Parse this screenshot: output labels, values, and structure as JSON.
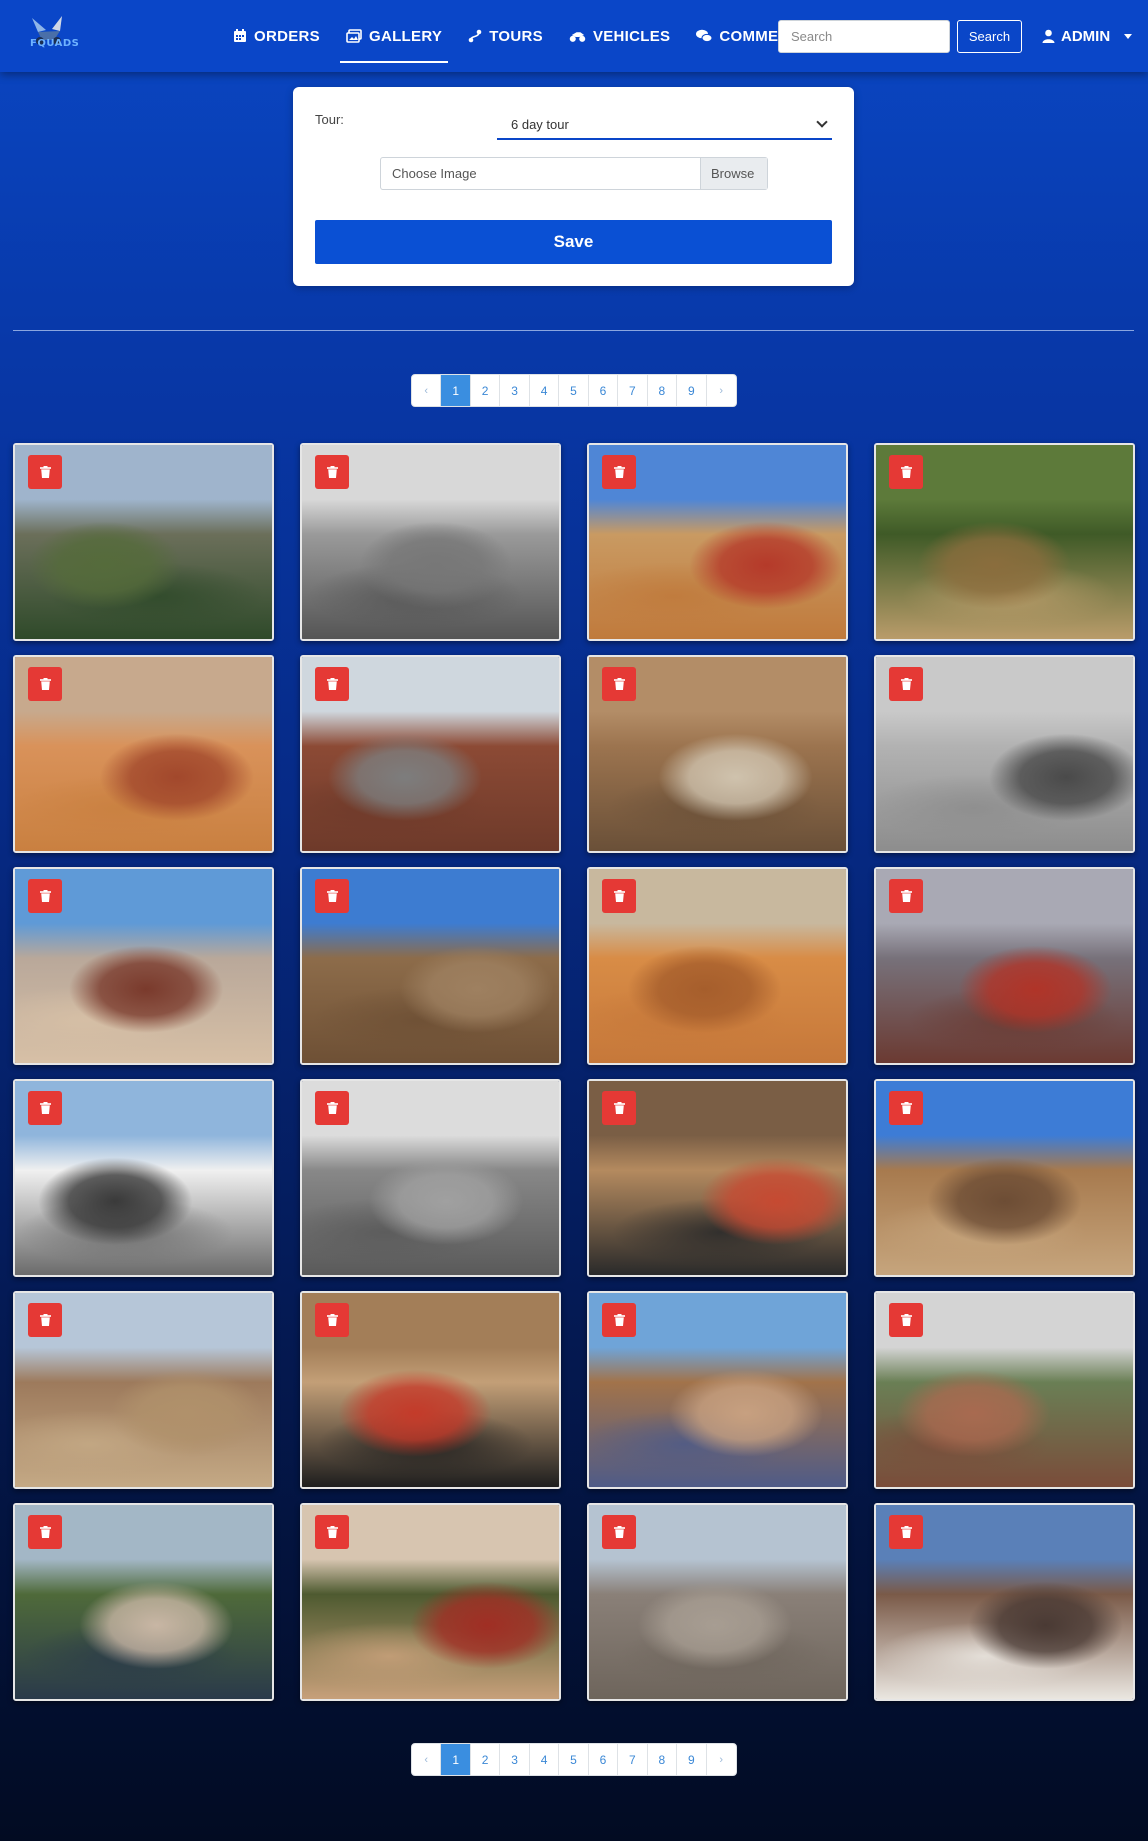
{
  "brand": {
    "logo_text": "FQUADS"
  },
  "nav": {
    "items": [
      {
        "label": "ORDERS",
        "icon": "calendar-icon"
      },
      {
        "label": "GALLERY",
        "icon": "images-icon",
        "active": true
      },
      {
        "label": "TOURS",
        "icon": "route-icon"
      },
      {
        "label": "VEHICLES",
        "icon": "quad-icon"
      },
      {
        "label": "COMMENTS",
        "icon": "comments-icon"
      }
    ],
    "search_placeholder": "Search",
    "search_button": "Search",
    "user_label": "ADMIN"
  },
  "form": {
    "tour_label": "Tour:",
    "tour_value": "6 day tour",
    "file_placeholder": "Choose Image",
    "browse_label": "Browse",
    "save_label": "Save"
  },
  "pagination": {
    "prev": "‹",
    "next": "›",
    "pages": [
      "1",
      "2",
      "3",
      "4",
      "5",
      "6",
      "7",
      "8",
      "9"
    ],
    "current": "1"
  },
  "colors": {
    "navbar": "#0a46c8",
    "accent": "#0a50d4",
    "delete": "#e53935",
    "page_active": "#3a8ee0"
  },
  "gallery": {
    "delete_icon": "trash-icon",
    "photos": [
      {
        "scene": "rider-in-helmet-palm-oasis",
        "palette": [
          "#9fb4cc",
          "#6b6f5a",
          "#2f4a2a",
          "#556b3b"
        ]
      },
      {
        "scene": "black-white-quad-palms",
        "palette": [
          "#d8d8d8",
          "#9a9a9a",
          "#555555",
          "#777777"
        ]
      },
      {
        "scene": "red-quads-on-dune",
        "palette": [
          "#4f86d6",
          "#c99a62",
          "#c07a3c",
          "#b53a2a"
        ]
      },
      {
        "scene": "quad-through-palm-grove",
        "palette": [
          "#5d7a3a",
          "#3f5a27",
          "#b99c6a",
          "#8a6d3d"
        ]
      },
      {
        "scene": "buggy-on-sand-dunes",
        "palette": [
          "#c7a98d",
          "#d9925a",
          "#c98040",
          "#a2482c"
        ]
      },
      {
        "scene": "quads-lined-before-kasbah",
        "palette": [
          "#cfd7de",
          "#8c4a35",
          "#6e3a2a",
          "#7d7d7d"
        ]
      },
      {
        "scene": "quads-in-canyon-gate",
        "palette": [
          "#b38d67",
          "#9c744f",
          "#6a5038",
          "#cfc2ad"
        ]
      },
      {
        "scene": "grey-quads-on-salt-flat",
        "palette": [
          "#c9c9c9",
          "#b2b2b2",
          "#8d8d8d",
          "#4a4a4a"
        ]
      },
      {
        "scene": "quad-near-kasbah-wall",
        "palette": [
          "#5f9ad7",
          "#b9a89a",
          "#d7c0a6",
          "#7a3a2c"
        ]
      },
      {
        "scene": "quad-on-rocky-plain",
        "palette": [
          "#3d7cd1",
          "#8d6c4a",
          "#6e5035",
          "#9e8060"
        ]
      },
      {
        "scene": "quads-on-orange-dunes",
        "palette": [
          "#c8b89e",
          "#d88c46",
          "#c6783a",
          "#a65e2c"
        ]
      },
      {
        "scene": "riders-celebrating-sunset",
        "palette": [
          "#a9a9b4",
          "#77717a",
          "#6b3a32",
          "#b03428"
        ]
      },
      {
        "scene": "hero-van-with-quads",
        "palette": [
          "#8fb5dc",
          "#f0f0f0",
          "#6b6b6b",
          "#3a3a3a"
        ]
      },
      {
        "scene": "bw-quads-rocky-hill",
        "palette": [
          "#dcdcdc",
          "#888888",
          "#5a5a5a",
          "#a0a0a0"
        ]
      },
      {
        "scene": "suv-in-village",
        "palette": [
          "#7a5e45",
          "#b48a5f",
          "#2a2a2a",
          "#c64a32"
        ]
      },
      {
        "scene": "quads-before-ait-ben-haddou",
        "palette": [
          "#3d7cd6",
          "#a77a4e",
          "#c6a57d",
          "#6d4d35"
        ]
      },
      {
        "scene": "quads-on-dusty-track",
        "palette": [
          "#b6c6d8",
          "#9d7a5c",
          "#c4a985",
          "#b0916b"
        ]
      },
      {
        "scene": "suv-with-graphics",
        "palette": [
          "#a37e58",
          "#c39f77",
          "#1e1e1e",
          "#c43b2a"
        ]
      },
      {
        "scene": "quad-in-souk-street",
        "palette": [
          "#6fa4d8",
          "#a2734a",
          "#4f5b87",
          "#c7a080"
        ]
      },
      {
        "scene": "quads-crossing-river",
        "palette": [
          "#d4d4d4",
          "#6a7f55",
          "#7a4c3a",
          "#a86a50"
        ]
      },
      {
        "scene": "quads-by-river-and-van",
        "palette": [
          "#a3b7c6",
          "#4f6a3a",
          "#2a3a4a",
          "#c8b6a4"
        ]
      },
      {
        "scene": "red-quads-in-palm-grove",
        "palette": [
          "#d7c5b0",
          "#4e5a30",
          "#c7a07a",
          "#a02e24"
        ]
      },
      {
        "scene": "dust-cloud-on-plain",
        "palette": [
          "#b5c3d1",
          "#8a8078",
          "#6e655c",
          "#a79d92"
        ]
      },
      {
        "scene": "quad-splash-river-kasbah",
        "palette": [
          "#5a80b8",
          "#7a5a48",
          "#eae6e0",
          "#4a3a34"
        ]
      }
    ]
  }
}
